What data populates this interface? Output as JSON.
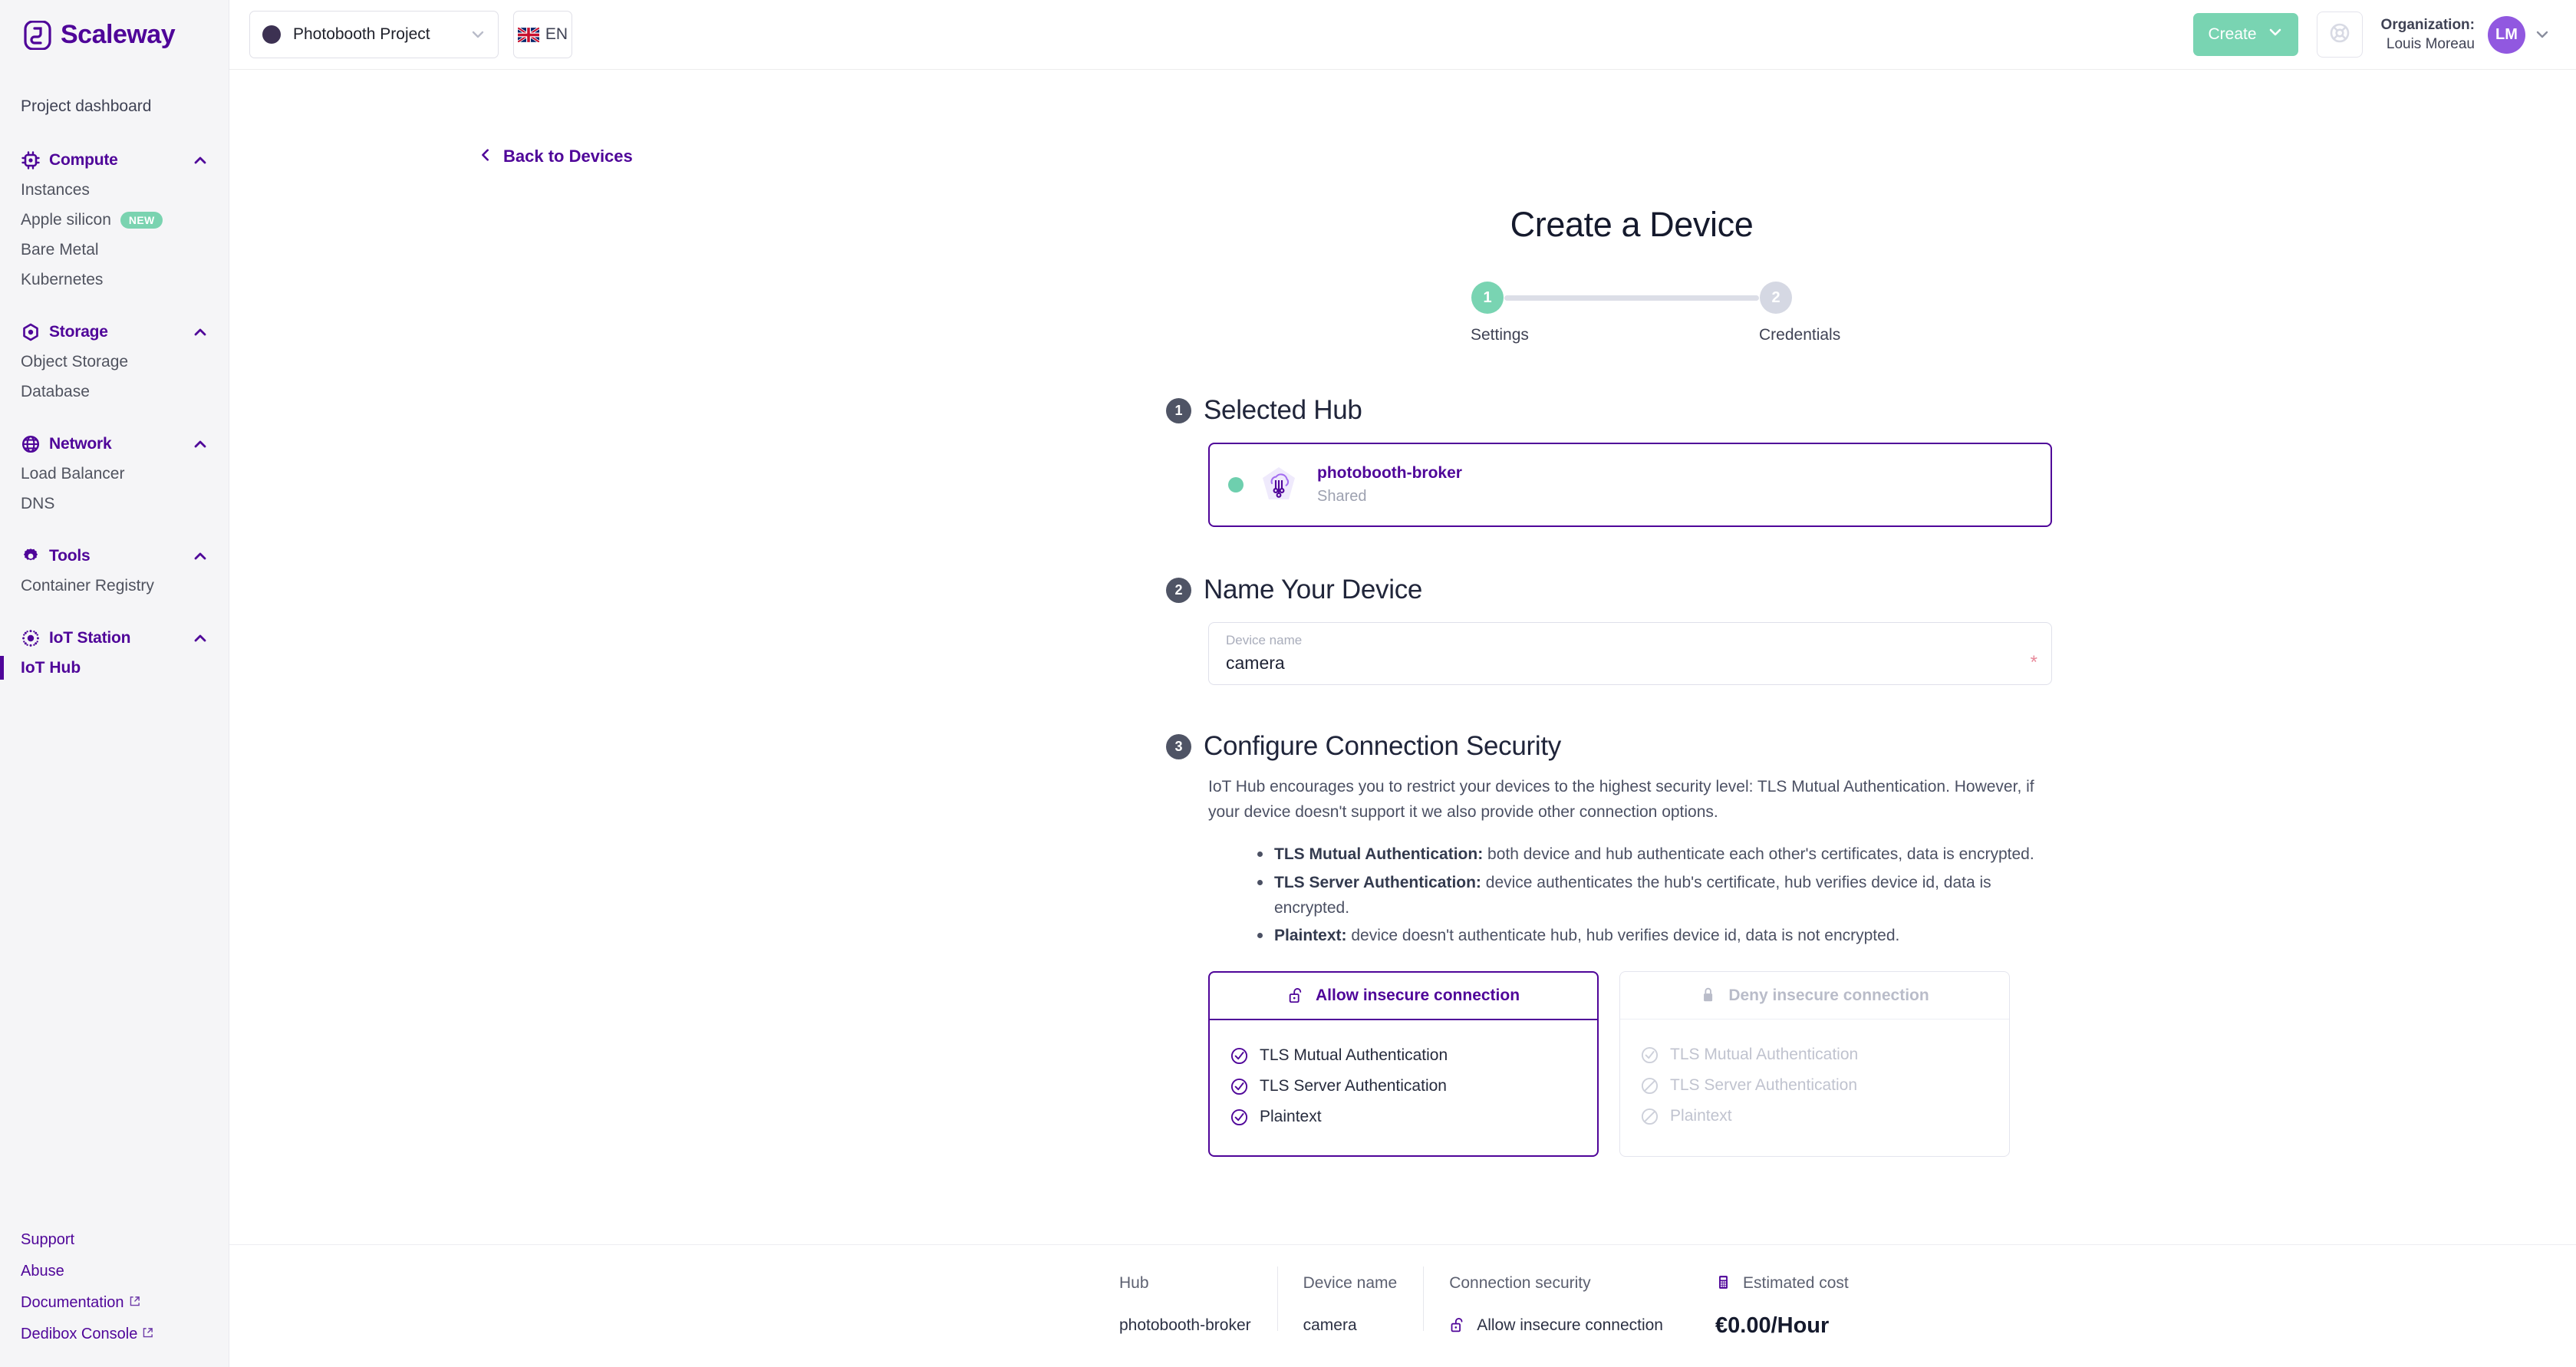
{
  "brand": {
    "name": "Scaleway",
    "accent": "#4f0599",
    "green": "#79d4b2"
  },
  "topbar": {
    "project": "Photobooth Project",
    "language": "EN",
    "create_label": "Create",
    "org_label": "Organization:",
    "org_name": "Louis Moreau",
    "avatar_initials": "LM"
  },
  "sidebar": {
    "dashboard": "Project dashboard",
    "groups": [
      {
        "title": "Compute",
        "icon": "chip-icon",
        "items": [
          {
            "label": "Instances"
          },
          {
            "label": "Apple silicon",
            "badge": "NEW"
          },
          {
            "label": "Bare Metal"
          },
          {
            "label": "Kubernetes"
          }
        ]
      },
      {
        "title": "Storage",
        "icon": "hexagon-icon",
        "items": [
          {
            "label": "Object Storage"
          },
          {
            "label": "Database"
          }
        ]
      },
      {
        "title": "Network",
        "icon": "globe-icon",
        "items": [
          {
            "label": "Load Balancer"
          },
          {
            "label": "DNS"
          }
        ]
      },
      {
        "title": "Tools",
        "icon": "gear-icon",
        "items": [
          {
            "label": "Container Registry"
          }
        ]
      },
      {
        "title": "IoT Station",
        "icon": "iot-icon",
        "items": [
          {
            "label": "IoT Hub",
            "active": true
          }
        ]
      }
    ],
    "footer_links": [
      {
        "label": "Support",
        "external": false
      },
      {
        "label": "Abuse",
        "external": false
      },
      {
        "label": "Documentation",
        "external": true
      },
      {
        "label": "Dedibox Console",
        "external": true
      }
    ]
  },
  "page": {
    "back_label": "Back to Devices",
    "title": "Create a Device",
    "steps": [
      {
        "number": "1",
        "label": "Settings",
        "state": "done"
      },
      {
        "number": "2",
        "label": "Credentials",
        "state": "todo"
      }
    ]
  },
  "sections": {
    "hub": {
      "number": "1",
      "title": "Selected Hub",
      "card": {
        "name": "photobooth-broker",
        "subtitle": "Shared",
        "status": "online"
      }
    },
    "name": {
      "number": "2",
      "title": "Name Your Device",
      "field_label": "Device name",
      "field_value": "camera",
      "placeholder": "Device name",
      "required_mark": "*"
    },
    "security": {
      "number": "3",
      "title": "Configure Connection Security",
      "description": "IoT Hub encourages you to restrict your devices to the highest security level: TLS Mutual Authentication. However, if your device doesn't support it we also provide other connection options.",
      "bullets": [
        {
          "term": "TLS Mutual Authentication:",
          "text": " both device and hub authenticate each other's certificates, data is encrypted."
        },
        {
          "term": "TLS Server Authentication:",
          "text": " device authenticates the hub's certificate, hub verifies device id, data is encrypted."
        },
        {
          "term": "Plaintext:",
          "text": " device doesn't authenticate hub, hub verifies device id, data is not encrypted."
        }
      ],
      "options": [
        {
          "label": "Allow insecure connection",
          "icon": "unlock-icon",
          "selected": true,
          "items": [
            {
              "label": "TLS Mutual Authentication",
              "icon": "check-circle-icon"
            },
            {
              "label": "TLS Server Authentication",
              "icon": "check-circle-icon"
            },
            {
              "label": "Plaintext",
              "icon": "check-circle-icon"
            }
          ]
        },
        {
          "label": "Deny insecure connection",
          "icon": "lock-icon",
          "selected": false,
          "items": [
            {
              "label": "TLS Mutual Authentication",
              "icon": "check-circle-icon"
            },
            {
              "label": "TLS Server Authentication",
              "icon": "blocked-circle-icon"
            },
            {
              "label": "Plaintext",
              "icon": "blocked-circle-icon"
            }
          ]
        }
      ]
    }
  },
  "summary": {
    "hub_label": "Hub",
    "hub_value": "photobooth-broker",
    "device_label": "Device name",
    "device_value": "camera",
    "security_label": "Connection security",
    "security_value": "Allow insecure connection",
    "cost_label": "Estimated cost",
    "cost_value": "€0.00/Hour"
  }
}
